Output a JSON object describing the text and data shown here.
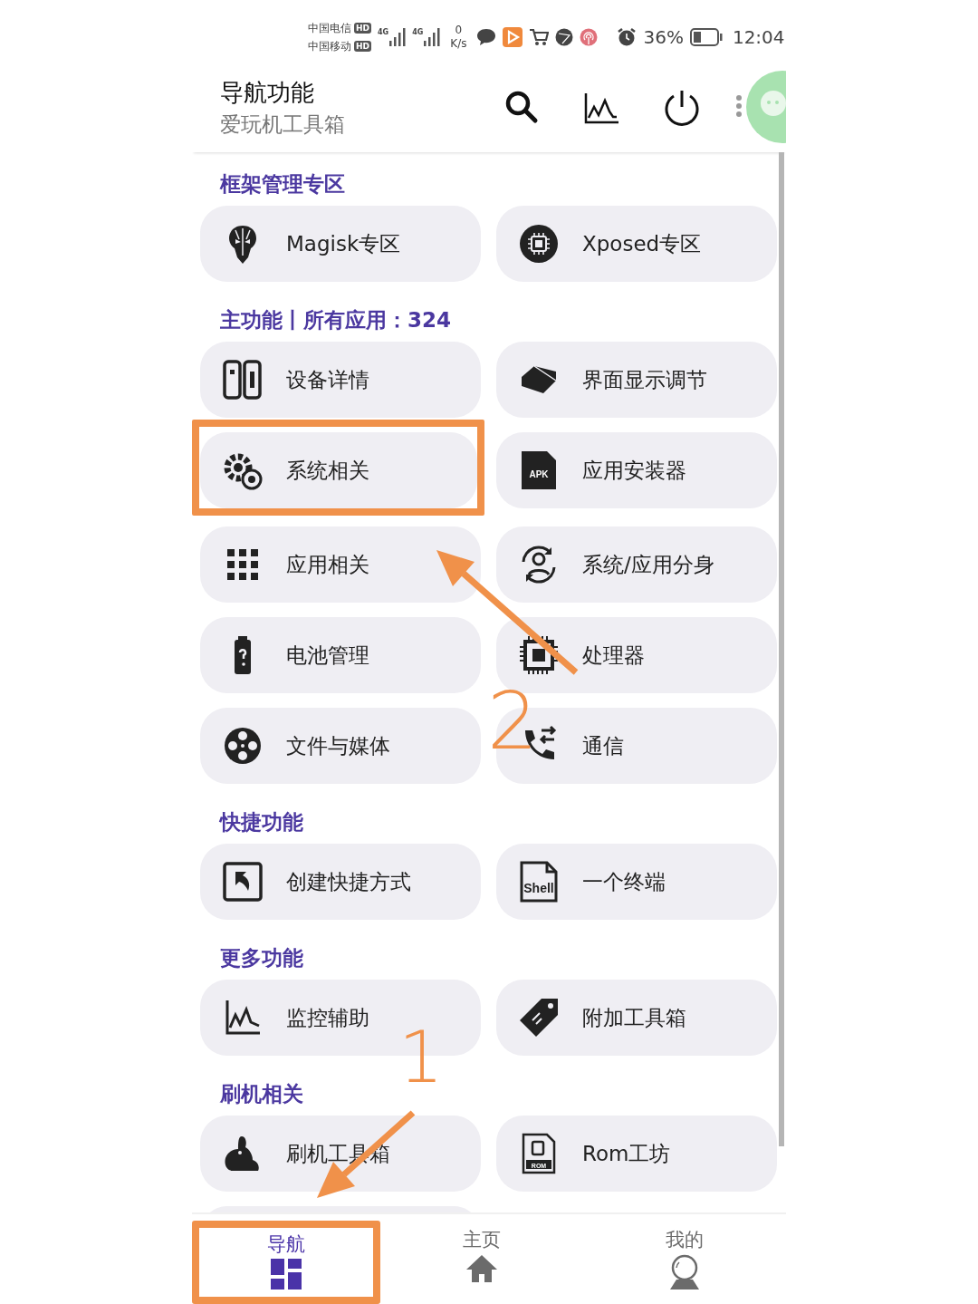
{
  "status_bar": {
    "carriers": [
      {
        "name": "中国电信",
        "badge": "HD"
      },
      {
        "name": "中国移动",
        "badge": "HD"
      }
    ],
    "networks": [
      "4G",
      "4G"
    ],
    "net_speed": {
      "value": "0",
      "unit": "K/s"
    },
    "battery": "36%",
    "time": "12:04"
  },
  "header": {
    "title": "导航功能",
    "subtitle": "爱玩机工具箱"
  },
  "sections": [
    {
      "title": "框架管理专区",
      "items": [
        {
          "label": "Magisk专区"
        },
        {
          "label": "Xposed专区"
        }
      ]
    },
    {
      "title": "主功能丨所有应用：324",
      "items": [
        {
          "label": "设备详情"
        },
        {
          "label": "界面显示调节"
        },
        {
          "label": "系统相关",
          "highlighted": true
        },
        {
          "label": "应用安装器",
          "badge": "APK"
        },
        {
          "label": "应用相关"
        },
        {
          "label": "系统/应用分身"
        },
        {
          "label": "电池管理"
        },
        {
          "label": "处理器"
        },
        {
          "label": "文件与媒体"
        },
        {
          "label": "通信"
        }
      ]
    },
    {
      "title": "快捷功能",
      "items": [
        {
          "label": "创建快捷方式"
        },
        {
          "label": "一个终端",
          "badge": "Shell"
        }
      ]
    },
    {
      "title": "更多功能",
      "items": [
        {
          "label": "监控辅助"
        },
        {
          "label": "附加工具箱"
        }
      ]
    },
    {
      "title": "刷机相关",
      "items": [
        {
          "label": "刷机工具箱"
        },
        {
          "label": "Rom工坊",
          "badge": "ROM"
        }
      ]
    }
  ],
  "nav": [
    {
      "label": "导航",
      "selected": true,
      "highlighted": true
    },
    {
      "label": "主页",
      "selected": false,
      "highlighted": false
    },
    {
      "label": "我的",
      "selected": false,
      "highlighted": false
    }
  ],
  "annotations": [
    {
      "label": "2"
    },
    {
      "label": "1"
    }
  ]
}
